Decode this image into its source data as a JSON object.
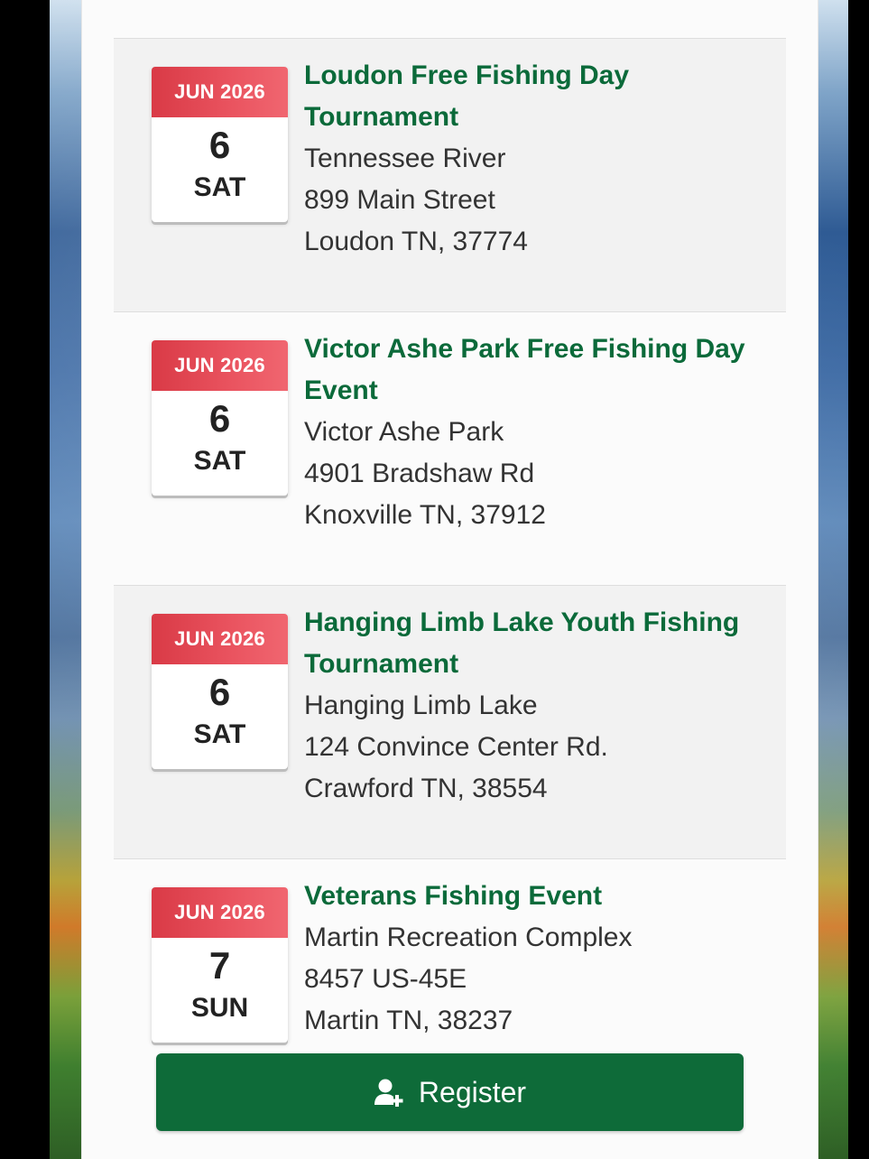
{
  "events": [
    {
      "month": "JUN 2026",
      "day": "6",
      "dow": "SAT",
      "title": "Loudon Free Fishing Day Tournament",
      "venue": "Tennessee River",
      "street": "899 Main Street",
      "city": "Loudon TN, 37774"
    },
    {
      "month": "JUN 2026",
      "day": "6",
      "dow": "SAT",
      "title": "Victor Ashe Park Free Fishing Day Event",
      "venue": "Victor Ashe Park",
      "street": "4901 Bradshaw Rd",
      "city": "Knoxville TN, 37912"
    },
    {
      "month": "JUN 2026",
      "day": "6",
      "dow": "SAT",
      "title": "Hanging Limb Lake Youth Fishing Tournament",
      "venue": "Hanging Limb Lake",
      "street": "124 Convince Center Rd.",
      "city": "Crawford TN, 38554"
    },
    {
      "month": "JUN 2026",
      "day": "7",
      "dow": "SUN",
      "title": "Veterans Fishing Event",
      "venue": "Martin Recreation Complex",
      "street": "8457 US-45E",
      "city": "Martin TN, 38237"
    }
  ],
  "register": {
    "label": "Register",
    "icon": "add-user-icon"
  },
  "colors": {
    "title_green": "#0b6a3a",
    "button_green": "#0e6b39",
    "month_red": "#e0434f"
  }
}
